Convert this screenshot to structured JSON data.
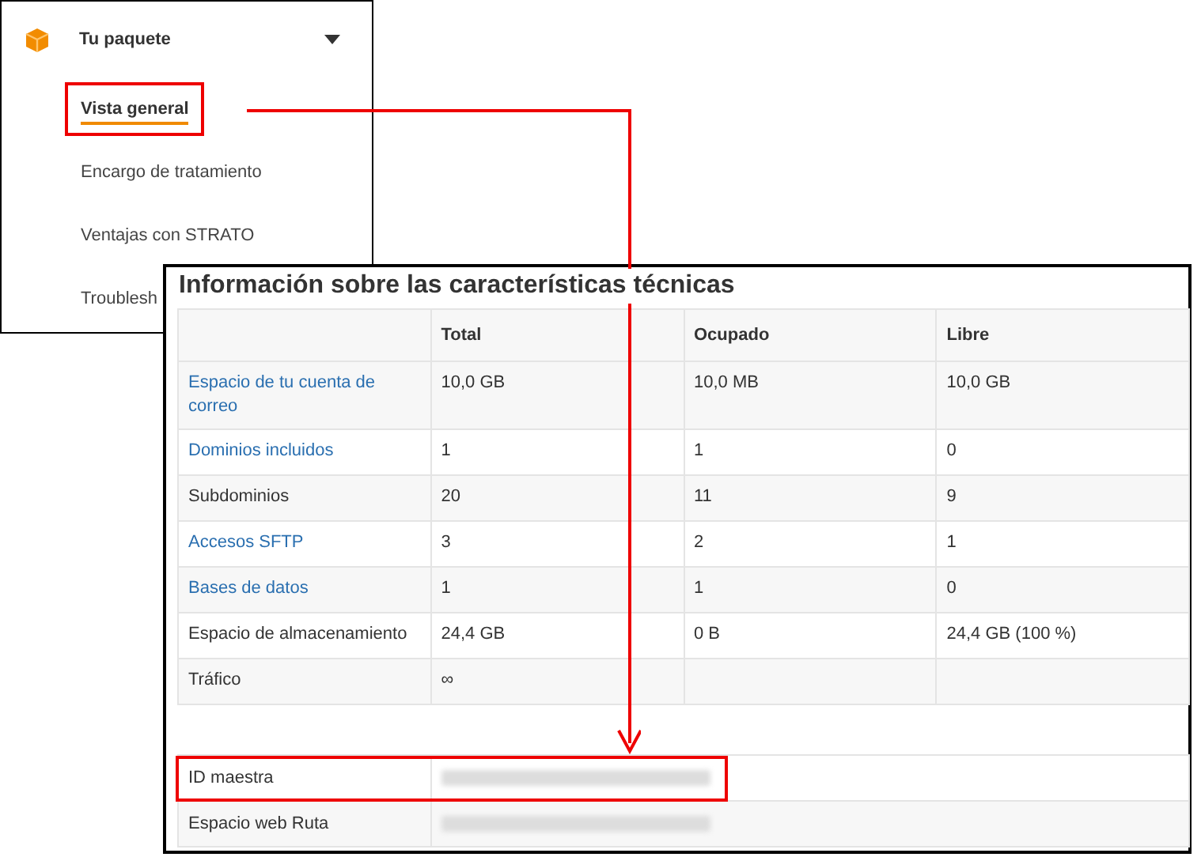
{
  "menu": {
    "title": "Tu paquete",
    "expanded": true,
    "items": [
      {
        "label": "Vista general",
        "selected": true,
        "highlighted": true
      },
      {
        "label": "Encargo de tratamiento",
        "selected": false,
        "highlighted": false
      },
      {
        "label": "Ventajas con STRATO",
        "selected": false,
        "highlighted": false
      },
      {
        "label": "Troublesh",
        "selected": false,
        "highlighted": false
      }
    ]
  },
  "specs": {
    "title": "Información sobre las características técnicas",
    "columns": [
      "Total",
      "Ocupado",
      "Libre"
    ],
    "rows": [
      {
        "label": "Espacio de tu cuenta de correo",
        "link": true,
        "values": [
          "10,0 GB",
          "10,0 MB",
          "10,0 GB"
        ]
      },
      {
        "label": "Dominios incluidos",
        "link": true,
        "values": [
          "1",
          "1",
          "0"
        ]
      },
      {
        "label": "Subdominios",
        "link": false,
        "values": [
          "20",
          "11",
          "9"
        ]
      },
      {
        "label": "Accesos SFTP",
        "link": true,
        "values": [
          "3",
          "2",
          "1"
        ]
      },
      {
        "label": "Bases de datos",
        "link": true,
        "values": [
          "1",
          "1",
          "0"
        ]
      },
      {
        "label": "Espacio de almacenamiento",
        "link": false,
        "values": [
          "24,4 GB",
          "0 B",
          "24,4 GB (100 %)"
        ]
      },
      {
        "label": "Tráfico",
        "link": false,
        "values": [
          "∞"
        ]
      }
    ],
    "info_rows": [
      {
        "label": "ID maestra",
        "redacted": true,
        "highlighted": true
      },
      {
        "label": "Espacio web Ruta",
        "redacted": true,
        "highlighted": false
      }
    ]
  }
}
